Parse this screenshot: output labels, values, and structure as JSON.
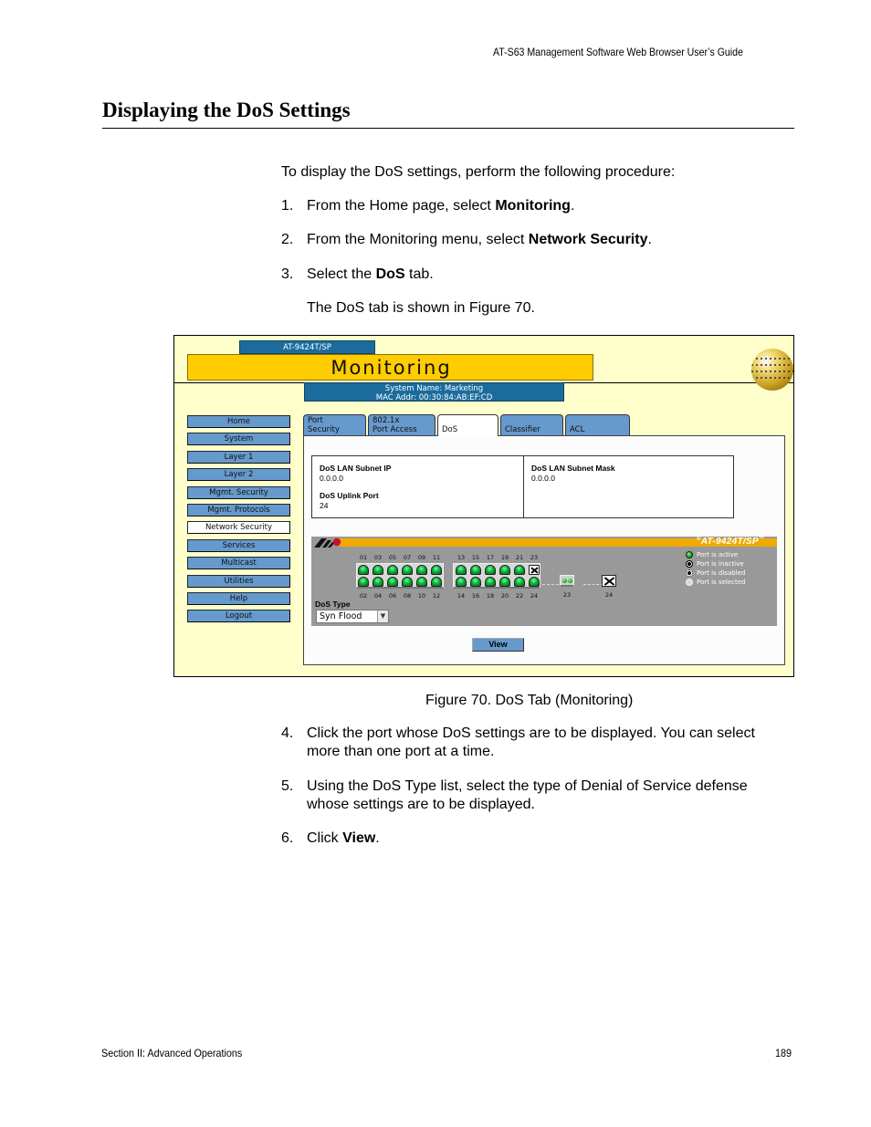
{
  "page": {
    "running_header": "AT-S63 Management Software Web Browser User’s Guide",
    "section_title": "Displaying the DoS Settings",
    "intro": "To display the DoS settings, perform the following procedure:",
    "steps": [
      {
        "num": "1.",
        "pre": "From the Home page, select ",
        "bold": "Monitoring",
        "post": "."
      },
      {
        "num": "2.",
        "pre": "From the Monitoring menu, select ",
        "bold": "Network Security",
        "post": "."
      },
      {
        "num": "3.",
        "pre": "Select the ",
        "bold": "DoS",
        "post": " tab."
      }
    ],
    "step3_note": "The DoS tab is shown in Figure 70.",
    "figure_caption": "Figure 70. DoS Tab (Monitoring)",
    "steps_after": [
      {
        "num": "4.",
        "line1": "Click the port whose DoS settings are to be displayed. You can select",
        "line2": "more than one port at a time."
      },
      {
        "num": "5.",
        "line1": "Using the DoS Type list, select the type of Denial of Service defense",
        "line2": "whose settings are to be displayed."
      },
      {
        "num": "6.",
        "pre": "Click ",
        "bold": "View",
        "post": "."
      }
    ],
    "footer_left": "Section II: Advanced Operations",
    "footer_right": "189"
  },
  "ui": {
    "model_tab": "AT-9424T/SP",
    "banner_title": "Monitoring",
    "system_name": "System Name: Marketing",
    "mac_addr": "MAC Addr: 00:30:84:AB:EF:CD",
    "nav": [
      {
        "label": "Home",
        "active": false
      },
      {
        "label": "System",
        "active": false
      },
      {
        "label": "Layer 1",
        "active": false
      },
      {
        "label": "Layer 2",
        "active": false
      },
      {
        "label": "Mgmt. Security",
        "active": false
      },
      {
        "label": "Mgmt. Protocols",
        "active": false
      },
      {
        "label": "Network Security",
        "active": true
      },
      {
        "label": "Services",
        "active": false
      },
      {
        "label": "Multicast",
        "active": false
      },
      {
        "label": "Utilities",
        "active": false
      },
      {
        "label": "Help",
        "active": false
      },
      {
        "label": "Logout",
        "active": false
      }
    ],
    "tabs": [
      {
        "label": "Port Security",
        "line1": "Port",
        "line2": "Security",
        "active": false
      },
      {
        "label": "802.1x Port Access",
        "line1": "802.1x",
        "line2": "Port Access",
        "active": false
      },
      {
        "label": "DoS",
        "line1": "",
        "line2": "DoS",
        "active": true
      },
      {
        "label": "Classifier",
        "line1": "",
        "line2": "Classifier",
        "active": false
      },
      {
        "label": "ACL",
        "line1": "",
        "line2": "ACL",
        "active": false
      }
    ],
    "dos_info": {
      "subnet_ip_label": "DoS LAN Subnet IP",
      "subnet_ip_value": "0.0.0.0",
      "uplink_port_label": "DoS Uplink Port",
      "uplink_port_value": "24",
      "subnet_mask_label": "DoS LAN Subnet Mask",
      "subnet_mask_value": "0.0.0.0"
    },
    "switch": {
      "model_label": "AT-9424T/SP",
      "top_ports": [
        "01",
        "03",
        "05",
        "07",
        "09",
        "11",
        "13",
        "15",
        "17",
        "19",
        "21",
        "23"
      ],
      "bottom_ports": [
        "02",
        "04",
        "06",
        "08",
        "10",
        "12",
        "14",
        "16",
        "18",
        "20",
        "22",
        "24"
      ],
      "top_status": [
        "active",
        "active",
        "active",
        "active",
        "active",
        "active",
        "active",
        "active",
        "active",
        "active",
        "active",
        "disabled"
      ],
      "bottom_status": [
        "active",
        "active",
        "active",
        "active",
        "active",
        "active",
        "active",
        "active",
        "active",
        "active",
        "active",
        "active"
      ],
      "uplink_ports": [
        {
          "label": "23",
          "status": "active"
        },
        {
          "label": "24",
          "status": "disabled"
        }
      ],
      "legend": [
        {
          "label": "Port is active",
          "status": "active"
        },
        {
          "label": "Port is inactive",
          "status": "inactive"
        },
        {
          "label": "Port is disabled",
          "status": "disabled"
        },
        {
          "label": "Port is selected",
          "status": "selected"
        }
      ]
    },
    "dos_type_label": "DoS Type",
    "dos_type_value": "Syn Flood",
    "view_button": "View"
  }
}
